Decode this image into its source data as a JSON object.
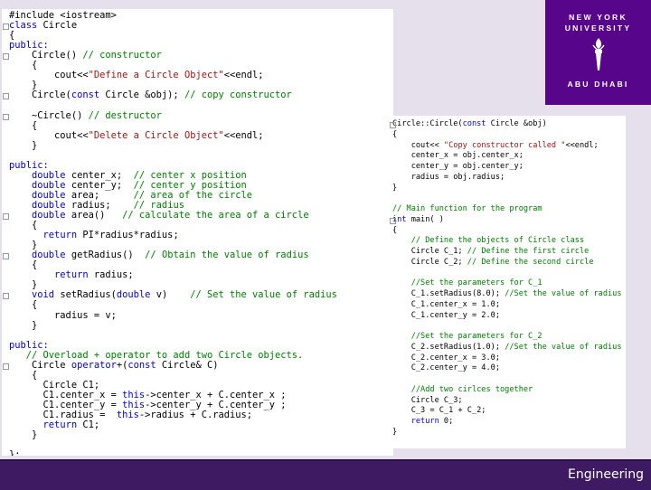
{
  "code_left": [
    [
      {
        "t": "#include <iostream>",
        "c": ""
      }
    ],
    [
      {
        "t": "class",
        "c": "kw"
      },
      {
        "t": " Circle",
        "c": ""
      }
    ],
    [
      {
        "t": "{",
        "c": ""
      }
    ],
    [
      {
        "t": "public:",
        "c": "kw"
      }
    ],
    [
      {
        "t": "    Circle() ",
        "c": ""
      },
      {
        "t": "// constructor",
        "c": "cm"
      }
    ],
    [
      {
        "t": "    {",
        "c": ""
      }
    ],
    [
      {
        "t": "        cout<<",
        "c": ""
      },
      {
        "t": "\"Define a Circle Object\"",
        "c": "st"
      },
      {
        "t": "<<endl;",
        "c": ""
      }
    ],
    [
      {
        "t": "    }",
        "c": ""
      }
    ],
    [
      {
        "t": "    Circle(",
        "c": ""
      },
      {
        "t": "const",
        "c": "kw"
      },
      {
        "t": " Circle &obj); ",
        "c": ""
      },
      {
        "t": "// copy constructor",
        "c": "cm"
      }
    ],
    [
      {
        "t": "",
        "c": ""
      }
    ],
    [
      {
        "t": "    ~Circle() ",
        "c": ""
      },
      {
        "t": "// destructor",
        "c": "cm"
      }
    ],
    [
      {
        "t": "    {",
        "c": ""
      }
    ],
    [
      {
        "t": "        cout<<",
        "c": ""
      },
      {
        "t": "\"Delete a Circle Object\"",
        "c": "st"
      },
      {
        "t": "<<endl;",
        "c": ""
      }
    ],
    [
      {
        "t": "    }",
        "c": ""
      }
    ],
    [
      {
        "t": "",
        "c": ""
      }
    ],
    [
      {
        "t": "public:",
        "c": "kw"
      }
    ],
    [
      {
        "t": "    ",
        "c": ""
      },
      {
        "t": "double",
        "c": "kw"
      },
      {
        "t": " center_x;  ",
        "c": ""
      },
      {
        "t": "// center x position",
        "c": "cm"
      }
    ],
    [
      {
        "t": "    ",
        "c": ""
      },
      {
        "t": "double",
        "c": "kw"
      },
      {
        "t": " center_y;  ",
        "c": ""
      },
      {
        "t": "// center y position",
        "c": "cm"
      }
    ],
    [
      {
        "t": "    ",
        "c": ""
      },
      {
        "t": "double",
        "c": "kw"
      },
      {
        "t": " area;      ",
        "c": ""
      },
      {
        "t": "// area of the circle",
        "c": "cm"
      }
    ],
    [
      {
        "t": "    ",
        "c": ""
      },
      {
        "t": "double",
        "c": "kw"
      },
      {
        "t": " radius;    ",
        "c": ""
      },
      {
        "t": "// radius",
        "c": "cm"
      }
    ],
    [
      {
        "t": "    ",
        "c": ""
      },
      {
        "t": "double",
        "c": "kw"
      },
      {
        "t": " area()   ",
        "c": ""
      },
      {
        "t": "// calculate the area of a circle",
        "c": "cm"
      }
    ],
    [
      {
        "t": "    {",
        "c": ""
      }
    ],
    [
      {
        "t": "      ",
        "c": ""
      },
      {
        "t": "return",
        "c": "kw"
      },
      {
        "t": " PI*radius*radius;",
        "c": ""
      }
    ],
    [
      {
        "t": "    }",
        "c": ""
      }
    ],
    [
      {
        "t": "    ",
        "c": ""
      },
      {
        "t": "double",
        "c": "kw"
      },
      {
        "t": " getRadius()  ",
        "c": ""
      },
      {
        "t": "// Obtain the value of radius",
        "c": "cm"
      }
    ],
    [
      {
        "t": "    {",
        "c": ""
      }
    ],
    [
      {
        "t": "        ",
        "c": ""
      },
      {
        "t": "return",
        "c": "kw"
      },
      {
        "t": " radius;",
        "c": ""
      }
    ],
    [
      {
        "t": "    }",
        "c": ""
      }
    ],
    [
      {
        "t": "    ",
        "c": ""
      },
      {
        "t": "void",
        "c": "kw"
      },
      {
        "t": " setRadius(",
        "c": ""
      },
      {
        "t": "double",
        "c": "kw"
      },
      {
        "t": " v)    ",
        "c": ""
      },
      {
        "t": "// Set the value of radius",
        "c": "cm"
      }
    ],
    [
      {
        "t": "    {",
        "c": ""
      }
    ],
    [
      {
        "t": "        radius = v;",
        "c": ""
      }
    ],
    [
      {
        "t": "    }",
        "c": ""
      }
    ],
    [
      {
        "t": "",
        "c": ""
      }
    ],
    [
      {
        "t": "public:",
        "c": "kw"
      }
    ],
    [
      {
        "t": "   ",
        "c": ""
      },
      {
        "t": "// Overload + operator to add two Circle objects.",
        "c": "cm"
      }
    ],
    [
      {
        "t": "    Circle ",
        "c": ""
      },
      {
        "t": "operator",
        "c": "kw"
      },
      {
        "t": "+(",
        "c": ""
      },
      {
        "t": "const",
        "c": "kw"
      },
      {
        "t": " Circle& C)",
        "c": ""
      }
    ],
    [
      {
        "t": "    {",
        "c": ""
      }
    ],
    [
      {
        "t": "      Circle C1;",
        "c": ""
      }
    ],
    [
      {
        "t": "      C1.center_x = ",
        "c": ""
      },
      {
        "t": "this",
        "c": "kw"
      },
      {
        "t": "->center_x + C.center_x ;",
        "c": ""
      }
    ],
    [
      {
        "t": "      C1.center_y = ",
        "c": ""
      },
      {
        "t": "this",
        "c": "kw"
      },
      {
        "t": "->center_y + C.center_y ;",
        "c": ""
      }
    ],
    [
      {
        "t": "      C1.radius =  ",
        "c": ""
      },
      {
        "t": "this",
        "c": "kw"
      },
      {
        "t": "->radius + C.radius;",
        "c": ""
      }
    ],
    [
      {
        "t": "      ",
        "c": ""
      },
      {
        "t": "return",
        "c": "kw"
      },
      {
        "t": " C1;",
        "c": ""
      }
    ],
    [
      {
        "t": "    }",
        "c": ""
      }
    ],
    [
      {
        "t": "",
        "c": ""
      }
    ],
    [
      {
        "t": "};",
        "c": ""
      }
    ]
  ],
  "code_right": [
    [
      {
        "t": "Circle::Circle(",
        "c": ""
      },
      {
        "t": "const",
        "c": "kw"
      },
      {
        "t": " Circle &obj)",
        "c": ""
      }
    ],
    [
      {
        "t": "{",
        "c": ""
      }
    ],
    [
      {
        "t": "    cout<< ",
        "c": ""
      },
      {
        "t": "\"Copy constructor called \"",
        "c": "st"
      },
      {
        "t": "<<endl;",
        "c": ""
      }
    ],
    [
      {
        "t": "    center_x = obj.center_x;",
        "c": ""
      }
    ],
    [
      {
        "t": "    center_y = obj.center_y;",
        "c": ""
      }
    ],
    [
      {
        "t": "    radius = obj.radius;",
        "c": ""
      }
    ],
    [
      {
        "t": "}",
        "c": ""
      }
    ],
    [
      {
        "t": "",
        "c": ""
      }
    ],
    [
      {
        "t": "// Main function for the program",
        "c": "cm"
      }
    ],
    [
      {
        "t": "int",
        "c": "kw"
      },
      {
        "t": " main( )",
        "c": ""
      }
    ],
    [
      {
        "t": "{",
        "c": ""
      }
    ],
    [
      {
        "t": "    ",
        "c": ""
      },
      {
        "t": "// Define the objects of Circle class",
        "c": "cm"
      }
    ],
    [
      {
        "t": "    Circle C_1; ",
        "c": ""
      },
      {
        "t": "// Define the first circle",
        "c": "cm"
      }
    ],
    [
      {
        "t": "    Circle C_2; ",
        "c": ""
      },
      {
        "t": "// Define the second circle",
        "c": "cm"
      }
    ],
    [
      {
        "t": "",
        "c": ""
      }
    ],
    [
      {
        "t": "    ",
        "c": ""
      },
      {
        "t": "//Set the parameters for C_1",
        "c": "cm"
      }
    ],
    [
      {
        "t": "    C_1.setRadius(8.0); ",
        "c": ""
      },
      {
        "t": "//Set the value of radius",
        "c": "cm"
      }
    ],
    [
      {
        "t": "    C_1.center_x = 1.0;",
        "c": ""
      }
    ],
    [
      {
        "t": "    C_1.center_y = 2.0;",
        "c": ""
      }
    ],
    [
      {
        "t": "",
        "c": ""
      }
    ],
    [
      {
        "t": "    ",
        "c": ""
      },
      {
        "t": "//Set the parameters for C_2",
        "c": "cm"
      }
    ],
    [
      {
        "t": "    C_2.setRadius(1.0); ",
        "c": ""
      },
      {
        "t": "//Set the value of radius",
        "c": "cm"
      }
    ],
    [
      {
        "t": "    C_2.center_x = 3.0;",
        "c": ""
      }
    ],
    [
      {
        "t": "    C_2.center_y = 4.0;",
        "c": ""
      }
    ],
    [
      {
        "t": "",
        "c": ""
      }
    ],
    [
      {
        "t": "    ",
        "c": ""
      },
      {
        "t": "//Add two cirlces together",
        "c": "cm"
      }
    ],
    [
      {
        "t": "    Circle C_3;",
        "c": ""
      }
    ],
    [
      {
        "t": "    C_3 = C_1 + C_2;",
        "c": ""
      }
    ],
    [
      {
        "t": "    ",
        "c": ""
      },
      {
        "t": "return",
        "c": "kw"
      },
      {
        "t": " 0;",
        "c": ""
      }
    ],
    [
      {
        "t": "}",
        "c": ""
      }
    ]
  ],
  "logo": {
    "line1": "NEW YORK",
    "line2": "UNIVERSITY",
    "line3": "ABU DHABI"
  },
  "footer": {
    "label": "Engineering"
  },
  "colors": {
    "brand_purple": "#57068c",
    "footer_bg": "#3e1a63",
    "keyword": "#0000e0",
    "comment": "#008000",
    "string": "#a31515"
  }
}
